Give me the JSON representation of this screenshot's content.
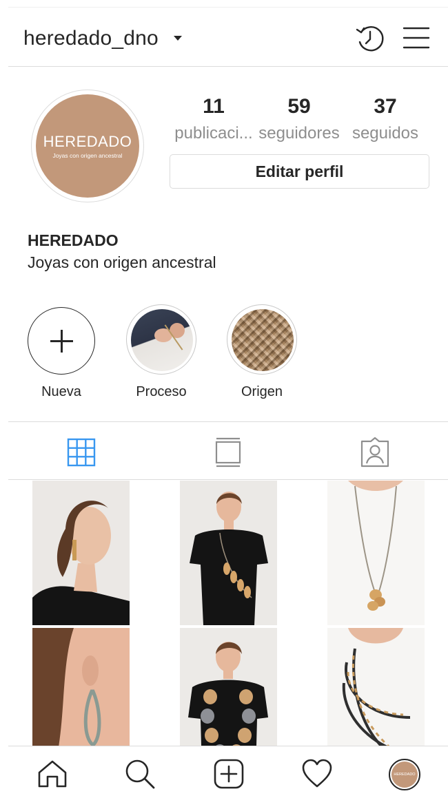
{
  "header": {
    "username": "heredado_dno"
  },
  "profile": {
    "avatar_brand": "HEREDADO",
    "avatar_tagline": "Joyas con origen ancestral",
    "stats": [
      {
        "value": "11",
        "label": "publicaci..."
      },
      {
        "value": "59",
        "label": "seguidores"
      },
      {
        "value": "37",
        "label": "seguidos"
      }
    ],
    "edit_button": "Editar perfil",
    "bio_name": "HEREDADO",
    "bio_text": "Joyas con origen ancestral"
  },
  "highlights": [
    {
      "label": "Nueva",
      "icon": "plus-icon"
    },
    {
      "label": "Proceso",
      "icon": "highlight-thumbnail"
    },
    {
      "label": "Origen",
      "icon": "highlight-thumbnail"
    }
  ],
  "tabs": [
    {
      "name": "grid",
      "icon": "grid-icon",
      "active": true
    },
    {
      "name": "feed",
      "icon": "feed-icon",
      "active": false
    },
    {
      "name": "tagged",
      "icon": "tagged-person-icon",
      "active": false
    }
  ],
  "bottom_nav": [
    {
      "name": "home",
      "icon": "home-icon"
    },
    {
      "name": "search",
      "icon": "search-icon"
    },
    {
      "name": "new-post",
      "icon": "add-post-icon"
    },
    {
      "name": "activity",
      "icon": "heart-icon"
    },
    {
      "name": "profile",
      "icon": "profile-avatar",
      "mini_text": "HEREDADO"
    }
  ],
  "colors": {
    "active_tab": "#3897f0",
    "brand": "#c2987a",
    "secondary_text": "#8e8e8e",
    "border": "#dbdbdb"
  }
}
